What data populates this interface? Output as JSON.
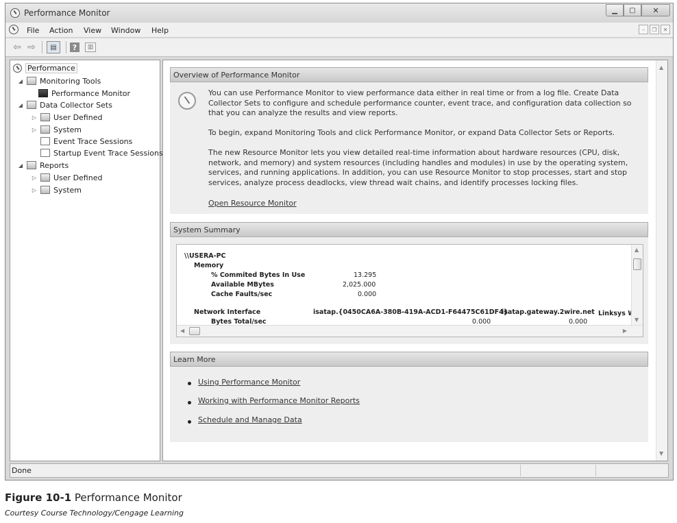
{
  "window": {
    "title": "Performance Monitor"
  },
  "menu": [
    "File",
    "Action",
    "View",
    "Window",
    "Help"
  ],
  "tree": [
    {
      "label": "Performance",
      "expander": "",
      "selected": true
    },
    {
      "label": "Monitoring Tools",
      "expander": "◢"
    },
    {
      "label": "Performance Monitor",
      "expander": ""
    },
    {
      "label": "Data Collector Sets",
      "expander": "◢"
    },
    {
      "label": "User Defined",
      "expander": "▷"
    },
    {
      "label": "System",
      "expander": "▷"
    },
    {
      "label": "Event Trace Sessions",
      "expander": ""
    },
    {
      "label": "Startup Event Trace Sessions",
      "expander": ""
    },
    {
      "label": "Reports",
      "expander": "◢"
    },
    {
      "label": "User Defined",
      "expander": "▷"
    },
    {
      "label": "System",
      "expander": "▷"
    }
  ],
  "overview": {
    "heading": "Overview of Performance Monitor",
    "p1": "You can use Performance Monitor to view performance data either in real time or from a log file. Create Data Collector Sets to configure and schedule performance counter, event trace, and configuration data collection so that you can analyze the results and view reports.",
    "p2": "To begin, expand Monitoring Tools and click Performance Monitor, or expand Data Collector Sets or Reports.",
    "p3": "The new Resource Monitor lets you view detailed real-time information about hardware resources (CPU, disk, network, and memory) and system resources (including handles and modules) in use by the operating system, services, and running applications. In addition, you can use Resource Monitor to stop processes, start and stop services, analyze process deadlocks, view thread wait chains, and identify processes locking files.",
    "link": "Open Resource Monitor"
  },
  "summary": {
    "heading": "System Summary",
    "computer": "\\\\USERA-PC",
    "memory_label": "Memory",
    "memory_rows": [
      {
        "name": "% Commited Bytes In Use",
        "value": "13.295"
      },
      {
        "name": "Available MBytes",
        "value": "2,025.000"
      },
      {
        "name": "Cache Faults/sec",
        "value": "0.000"
      }
    ],
    "network_label": "Network Interface",
    "network_columns": [
      "isatap.{0450CA6A-380B-419A-ACD1-F64475C61DF4}",
      "isatap.gateway.2wire.net",
      "Linksys W"
    ],
    "network_row": {
      "name": "Bytes Total/sec",
      "values": [
        "0.000",
        "0.000"
      ]
    }
  },
  "learn_more": {
    "heading": "Learn More",
    "links": [
      "Using Performance Monitor",
      "Working with Performance Monitor Reports",
      "Schedule and Manage Data"
    ]
  },
  "status": {
    "text": "Done"
  },
  "caption": {
    "figure": "Figure 10-1",
    "title": "Performance Monitor",
    "credit": "Courtesy Course Technology/Cengage Learning"
  }
}
